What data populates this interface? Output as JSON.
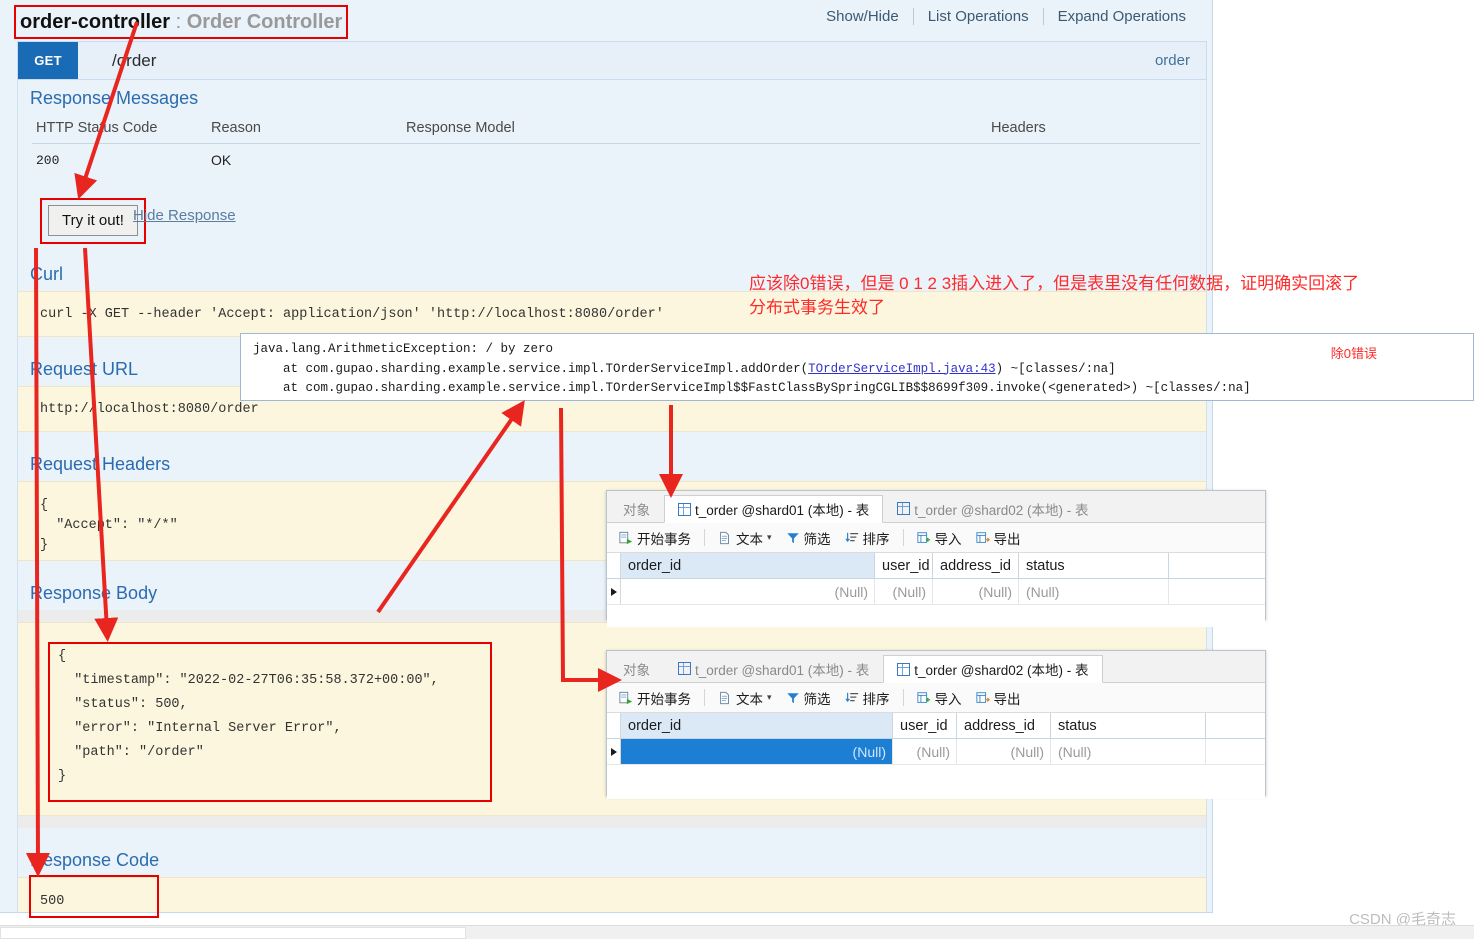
{
  "header": {
    "api_title_main": "order-controller",
    "api_title_sep": " : ",
    "api_title_sub": "Order Controller",
    "links": [
      "Show/Hide",
      "List Operations",
      "Expand Operations"
    ]
  },
  "operation": {
    "method": "GET",
    "path": "/order",
    "tag": "order"
  },
  "response_messages": {
    "heading": "Response Messages",
    "columns": [
      "HTTP Status Code",
      "Reason",
      "Response Model",
      "Headers"
    ],
    "rows": [
      {
        "code": "200",
        "reason": "OK",
        "model": "",
        "headers": ""
      }
    ]
  },
  "actions": {
    "try_it_out": "Try it out!",
    "hide_response": "Hide Response"
  },
  "sections": {
    "curl_heading": "Curl",
    "curl_value": "curl -X GET --header 'Accept: application/json' 'http://localhost:8080/order'",
    "request_url_heading": "Request URL",
    "request_url_value": "http://localhost:8080/order",
    "request_headers_heading": "Request Headers",
    "request_headers_value": "{\n  \"Accept\": \"*/*\"\n}",
    "response_body_heading": "Response Body",
    "response_body_value": "{\n  \"timestamp\": \"2022-02-27T06:35:58.372+00:00\",\n  \"status\": 500,\n  \"error\": \"Internal Server Error\",\n  \"path\": \"/order\"\n}",
    "response_code_heading": "Response Code",
    "response_code_value": "500"
  },
  "stack_trace": {
    "line1": "java.lang.ArithmeticException: / by zero",
    "line2_pre": "    at com.gupao.sharding.example.service.impl.TOrderServiceImpl.addOrder(",
    "line2_link": "TOrderServiceImpl.java:43",
    "line2_post": ") ~[classes/:na]",
    "line3": "    at com.gupao.sharding.example.service.impl.TOrderServiceImpl$$FastClassBySpringCGLIB$$8699f309.invoke(<generated>) ~[classes/:na]",
    "note": "除0错误"
  },
  "annotations": {
    "chinese_note_line1": "应该除0错误，但是 0 1 2 3插入进入了，但是表里没有任何数据，证明确实回滚了",
    "chinese_note_line2": "分布式事务生效了"
  },
  "navicat_windows": [
    {
      "tabs": [
        {
          "label": "对象",
          "active": false,
          "has_icon": false
        },
        {
          "label": "t_order @shard01 (本地) - 表",
          "active": true,
          "has_icon": true
        },
        {
          "label": "t_order @shard02 (本地) - 表",
          "active": false,
          "has_icon": true
        }
      ],
      "toolbar": [
        "开始事务",
        "文本",
        "筛选",
        "排序",
        "导入",
        "导出"
      ],
      "columns": [
        "order_id",
        "user_id",
        "address_id",
        "status"
      ],
      "rows": [
        {
          "cells": [
            "(Null)",
            "(Null)",
            "(Null)",
            "(Null)"
          ],
          "selected": false
        }
      ]
    },
    {
      "tabs": [
        {
          "label": "对象",
          "active": false,
          "has_icon": false
        },
        {
          "label": "t_order @shard01 (本地) - 表",
          "active": false,
          "has_icon": true
        },
        {
          "label": "t_order @shard02 (本地) - 表",
          "active": true,
          "has_icon": true
        }
      ],
      "toolbar": [
        "开始事务",
        "文本",
        "筛选",
        "排序",
        "导入",
        "导出"
      ],
      "columns": [
        "order_id",
        "user_id",
        "address_id",
        "status"
      ],
      "rows": [
        {
          "cells": [
            "(Null)",
            "(Null)",
            "(Null)",
            "(Null)"
          ],
          "selected": true
        }
      ]
    }
  ],
  "watermark": "CSDN @毛奇志",
  "colors": {
    "accent_blue": "#1a6bb5",
    "panel_bg": "#eaf2fa",
    "code_bg": "#fbf6dd",
    "annotation_red": "#e60000",
    "selection_blue": "#1d7fd4"
  }
}
